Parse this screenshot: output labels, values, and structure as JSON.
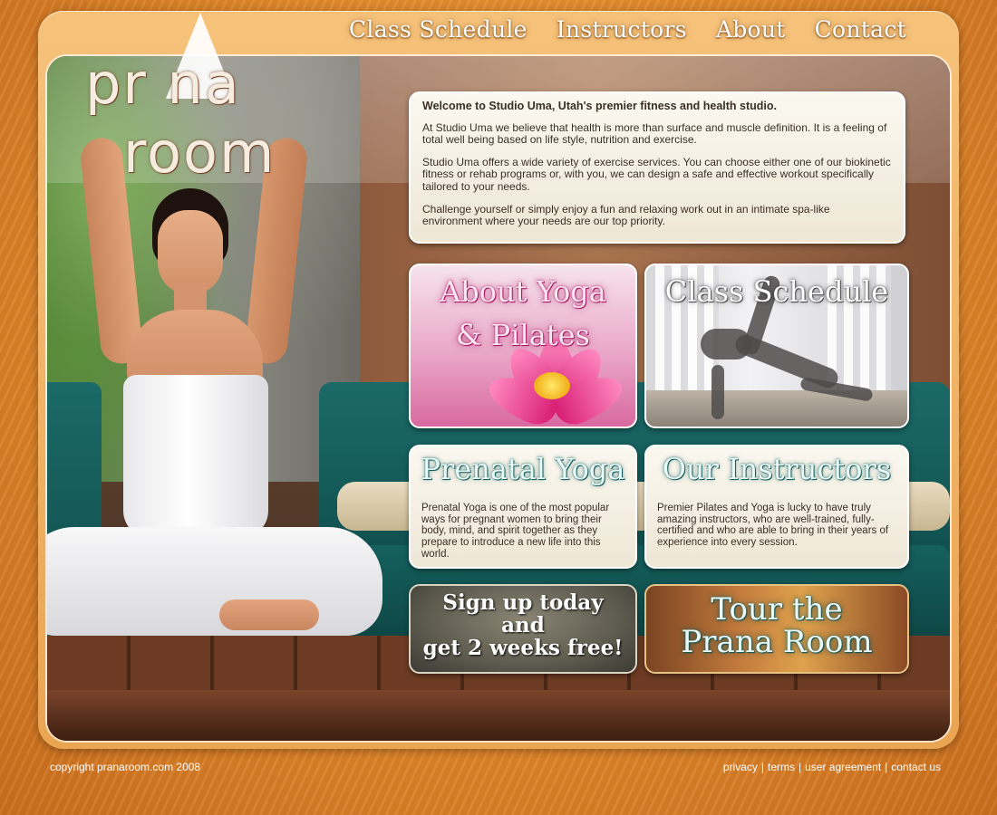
{
  "nav": {
    "items": [
      {
        "label": "Class Schedule"
      },
      {
        "label": "Instructors"
      },
      {
        "label": "About"
      },
      {
        "label": "Contact"
      }
    ]
  },
  "logo": {
    "line1": "pr  na",
    "line2": "room"
  },
  "welcome": {
    "title": "Welcome to Studio Uma, Utah's premier fitness and health studio.",
    "paragraphs": [
      "At Studio Uma we believe that health is more than surface and muscle definition.  It is a feeling of total well being based on life style, nutrition and exercise.",
      "Studio Uma offers a wide variety of exercise services.  You can choose either one of our biokinetic fitness or rehab programs or, with you, we can design a safe and effective workout specifically tailored to your needs.",
      "Challenge yourself or simply enjoy a fun and relaxing work out in an intimate spa-like environment where your needs are our top priority."
    ]
  },
  "tiles": {
    "yoga": {
      "title_line1": "About Yoga",
      "title_line2": "& Pilates"
    },
    "schedule": {
      "title": "Class Schedule"
    },
    "prenatal": {
      "title": "Prenatal Yoga",
      "body": "Prenatal Yoga is one of the most popular ways for pregnant women to bring their body, mind, and spirit together as they prepare to introduce a new life into this world."
    },
    "instructors": {
      "title": "Our Instructors",
      "body": "Premier Pilates and Yoga is lucky to have truly amazing instructors, who are well-trained, fully-certified and who are able to bring in their years of experience into every session."
    },
    "signup": {
      "line1": "Sign up today",
      "line2": "and",
      "line3": "get 2 weeks free!"
    },
    "tour": {
      "line1": "Tour the",
      "line2": "Prana Room"
    }
  },
  "footer": {
    "copyright": "copyright pranaroom.com 2008",
    "links": [
      {
        "label": "privacy"
      },
      {
        "label": "terms"
      },
      {
        "label": "user agreement"
      },
      {
        "label": "contact us"
      }
    ],
    "separator": "|"
  },
  "colors": {
    "background": "#e0872a",
    "frame": "#f6c27a",
    "pink_accent": "#d81d74",
    "teal_accent": "#1e6e6c"
  }
}
